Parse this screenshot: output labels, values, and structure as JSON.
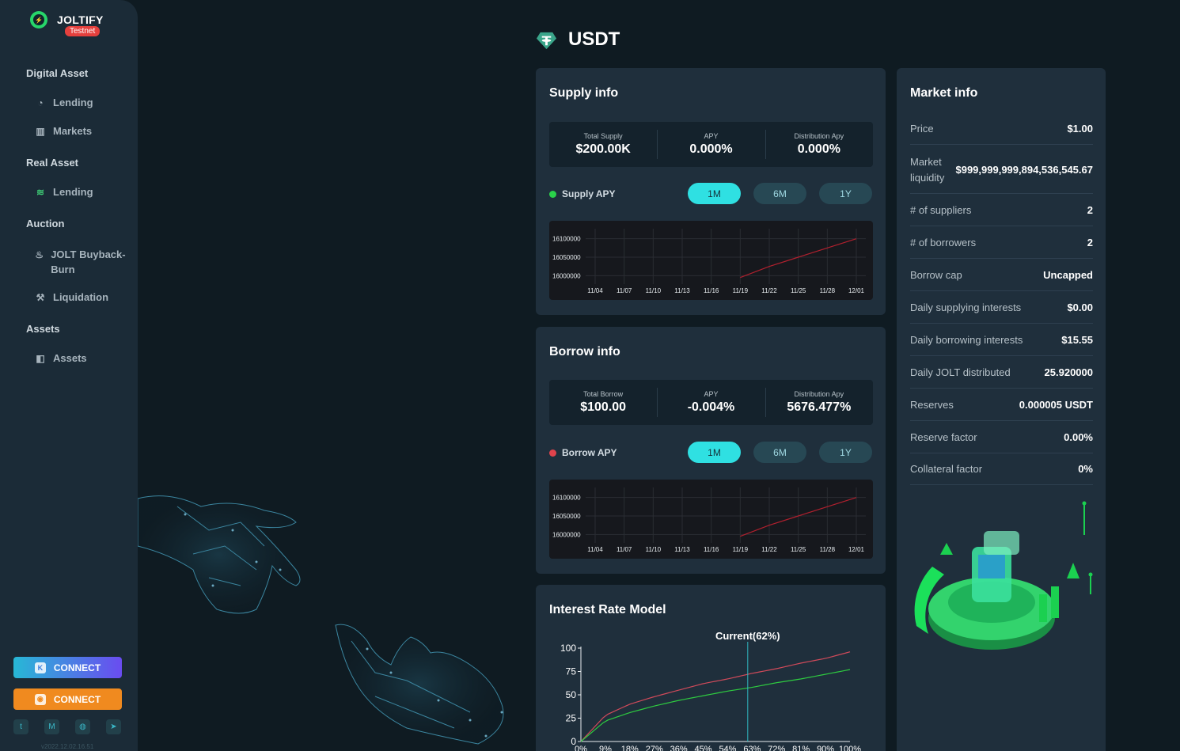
{
  "app": {
    "name": "JOLTIFY",
    "badge": "Testnet",
    "version": "v2022.12.02.16.51"
  },
  "sidebar": {
    "sections": [
      {
        "title": "Digital Asset",
        "items": [
          {
            "label": "Lending",
            "icon": "pie-chart-icon"
          },
          {
            "label": "Markets",
            "icon": "bar-chart-icon"
          }
        ]
      },
      {
        "title": "Real Asset",
        "items": [
          {
            "label": "Lending",
            "icon": "coin-stack-icon"
          }
        ]
      },
      {
        "title": "Auction",
        "items": [
          {
            "label": "JOLT Buyback-Burn",
            "icon": "flame-icon"
          },
          {
            "label": "Liquidation",
            "icon": "gavel-icon"
          }
        ]
      },
      {
        "title": "Assets",
        "items": [
          {
            "label": "Assets",
            "icon": "wallet-icon"
          }
        ]
      }
    ],
    "connect_keplr": "CONNECT",
    "connect_metamask": "CONNECT",
    "socials": [
      "twitter-icon",
      "medium-icon",
      "discord-icon",
      "telegram-icon"
    ]
  },
  "asset": {
    "symbol": "USDT"
  },
  "supply": {
    "title": "Supply info",
    "stats": [
      {
        "label": "Total Supply",
        "value": "$200.00K"
      },
      {
        "label": "APY",
        "value": "0.000%"
      },
      {
        "label": "Distribution Apy",
        "value": "0.000%"
      }
    ],
    "legend": "Supply APY",
    "legend_color": "#2ad14a",
    "ranges": [
      "1M",
      "6M",
      "1Y"
    ],
    "active_range": "1M"
  },
  "borrow": {
    "title": "Borrow info",
    "stats": [
      {
        "label": "Total Borrow",
        "value": "$100.00"
      },
      {
        "label": "APY",
        "value": "-0.004%"
      },
      {
        "label": "Distribution Apy",
        "value": "5676.477%"
      }
    ],
    "legend": "Borrow APY",
    "legend_color": "#e0434c",
    "ranges": [
      "1M",
      "6M",
      "1Y"
    ],
    "active_range": "1M"
  },
  "chart_data": [
    {
      "type": "line",
      "x": [
        "11/04",
        "11/07",
        "11/10",
        "11/13",
        "11/16",
        "11/19",
        "11/22",
        "11/25",
        "11/28",
        "12/01"
      ],
      "y_ticks": [
        "16100000",
        "16050000",
        "16000000"
      ],
      "series": [
        {
          "values": [
            null,
            null,
            null,
            null,
            null,
            15995000,
            16025000,
            16050000,
            16075000,
            16100000
          ],
          "color": "#b0202e"
        }
      ]
    },
    {
      "type": "line",
      "x": [
        "11/04",
        "11/07",
        "11/10",
        "11/13",
        "11/16",
        "11/19",
        "11/22",
        "11/25",
        "11/28",
        "12/01"
      ],
      "y_ticks": [
        "16100000",
        "16050000",
        "16000000"
      ],
      "series": [
        {
          "values": [
            null,
            null,
            null,
            null,
            null,
            15995000,
            16025000,
            16050000,
            16075000,
            16100000
          ],
          "color": "#b0202e"
        }
      ]
    },
    {
      "type": "line",
      "x": [
        "0%",
        "9%",
        "18%",
        "27%",
        "36%",
        "45%",
        "54%",
        "63%",
        "72%",
        "81%",
        "90%",
        "100%"
      ],
      "y_ticks": [
        "100",
        "75",
        "50",
        "25",
        "0"
      ],
      "ylim": [
        0,
        100
      ],
      "annotation": "Current(62%)",
      "current_utilization": 62,
      "series": [
        {
          "color": "#d04a5a",
          "values": [
            0,
            28,
            40,
            48,
            55,
            62,
            67,
            73,
            78,
            84,
            89,
            96
          ]
        },
        {
          "color": "#2ecc40",
          "values": [
            0,
            22,
            31,
            38,
            44,
            49,
            54,
            58,
            63,
            67,
            72,
            77
          ]
        }
      ]
    }
  ],
  "interest_model": {
    "title": "Interest Rate Model"
  },
  "market": {
    "title": "Market info",
    "rows": [
      {
        "k": "Price",
        "v": "$1.00"
      },
      {
        "k": "Market liquidity",
        "v": "$999,999,999,894,536,545.67"
      },
      {
        "k": "# of suppliers",
        "v": "2"
      },
      {
        "k": "# of borrowers",
        "v": "2"
      },
      {
        "k": "Borrow cap",
        "v": "Uncapped"
      },
      {
        "k": "Daily supplying interests",
        "v": "$0.00"
      },
      {
        "k": "Daily borrowing interests",
        "v": "$15.55"
      },
      {
        "k": "Daily JOLT distributed",
        "v": "25.920000"
      },
      {
        "k": "Reserves",
        "v": "0.000005 USDT"
      },
      {
        "k": "Reserve factor",
        "v": "0.00%"
      },
      {
        "k": "Collateral factor",
        "v": "0%"
      }
    ]
  }
}
